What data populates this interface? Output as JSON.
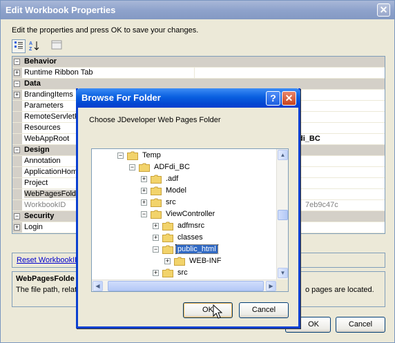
{
  "outer": {
    "title": "Edit Workbook Properties",
    "close_glyph": "✕",
    "instructions": "Edit the properties and press OK to save your changes.",
    "toolbar": {
      "categorized_icon": "categorized-icon",
      "alpha_icon": "sort-alphabetical-icon",
      "pages_icon": "property-pages-icon"
    },
    "grid": {
      "rows": [
        {
          "type": "category",
          "expander": "⊟",
          "name": "Behavior"
        },
        {
          "type": "prop",
          "expander": "+",
          "name": "Runtime Ribbon Tab",
          "value": ""
        },
        {
          "type": "category",
          "expander": "⊟",
          "name": "Data"
        },
        {
          "type": "prop",
          "expander": "+",
          "name": "BrandingItems",
          "value": ""
        },
        {
          "type": "prop",
          "expander": "",
          "name": "Parameters",
          "value": ""
        },
        {
          "type": "prop",
          "expander": "",
          "name": "RemoteServletF",
          "value": ""
        },
        {
          "type": "prop",
          "expander": "",
          "name": "Resources",
          "value": ""
        },
        {
          "type": "prop",
          "expander": "",
          "name": "WebAppRoot",
          "value": "di_BC"
        },
        {
          "type": "category",
          "expander": "⊟",
          "name": "Design"
        },
        {
          "type": "prop",
          "expander": "",
          "name": "Annotation",
          "value": ""
        },
        {
          "type": "prop",
          "expander": "",
          "name": "ApplicationHome",
          "value": ""
        },
        {
          "type": "prop",
          "expander": "",
          "name": "Project",
          "value": ""
        },
        {
          "type": "prop",
          "expander": "",
          "name": "WebPagesFolde",
          "value": "",
          "selected": true
        },
        {
          "type": "prop",
          "expander": "",
          "name": "WorkbookID",
          "value": "7eb9c47c",
          "disabled": true
        },
        {
          "type": "category",
          "expander": "⊟",
          "name": "Security"
        },
        {
          "type": "prop",
          "expander": "+",
          "name": "Login",
          "value": ""
        }
      ]
    },
    "reset_link": "Reset WorkbookID",
    "description": {
      "title": "WebPagesFolde",
      "text": "The file path, relat",
      "tail": "o pages are located."
    },
    "ok_label": "OK",
    "cancel_label": "Cancel"
  },
  "dialog": {
    "title": "Browse For Folder",
    "help_glyph": "?",
    "close_glyph": "✕",
    "instructions": "Choose JDeveloper Web Pages Folder",
    "tree": [
      {
        "label": "Temp",
        "pm": "−",
        "depth": 0
      },
      {
        "label": "ADFdi_BC",
        "pm": "−",
        "depth": 1
      },
      {
        "label": ".adf",
        "pm": "+",
        "depth": 2
      },
      {
        "label": "Model",
        "pm": "+",
        "depth": 2
      },
      {
        "label": "src",
        "pm": "+",
        "depth": 2
      },
      {
        "label": "ViewController",
        "pm": "−",
        "depth": 2
      },
      {
        "label": "adfmsrc",
        "pm": "+",
        "depth": 3
      },
      {
        "label": "classes",
        "pm": "+",
        "depth": 3
      },
      {
        "label": "public_html",
        "pm": "−",
        "depth": 3,
        "selected": true
      },
      {
        "label": "WEB-INF",
        "pm": "+",
        "depth": 4
      },
      {
        "label": "src",
        "pm": "+",
        "depth": 3
      }
    ],
    "ok_label": "OK",
    "cancel_label": "Cancel"
  },
  "colors": {
    "folder": "#f2d36b",
    "folder_edge": "#c9a23a",
    "selection": "#316ac5",
    "link": "#0000cc"
  }
}
